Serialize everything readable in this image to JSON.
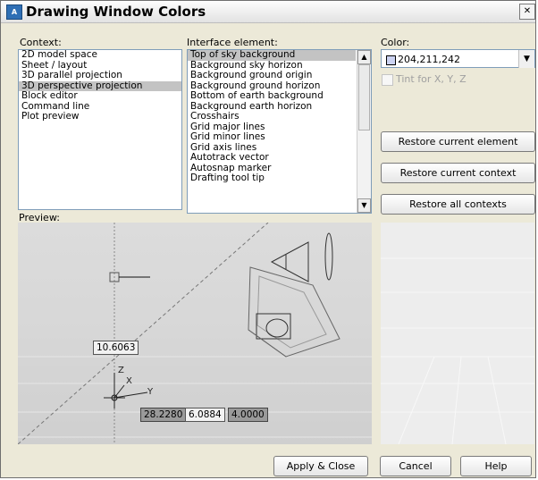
{
  "window": {
    "title": "Drawing Window Colors",
    "icon_label": "A",
    "close_glyph": "✕"
  },
  "context": {
    "label": "Context:",
    "items": [
      "2D model space",
      "Sheet / layout",
      "3D parallel projection",
      "3D perspective projection",
      "Block editor",
      "Command line",
      "Plot preview"
    ],
    "selected": "3D perspective projection"
  },
  "interface_element": {
    "label": "Interface element:",
    "items": [
      "Top of sky background",
      "Background sky horizon",
      "Background ground origin",
      "Background ground horizon",
      "Bottom of earth background",
      "Background earth horizon",
      "Crosshairs",
      "Grid major lines",
      "Grid minor lines",
      "Grid axis lines",
      "Autotrack vector",
      "Autosnap marker",
      "Drafting tool tip"
    ],
    "selected": "Top of sky background",
    "scroll_up_icon": "scroll-up-arrow",
    "scroll_down_icon": "scroll-down-arrow"
  },
  "color": {
    "label": "Color:",
    "value": "204,211,242",
    "swatch_color": "#ccd3f2",
    "tint_label": "Tint for X, Y, Z"
  },
  "buttons": {
    "restore_element": "Restore current element",
    "restore_context": "Restore current context",
    "restore_all": "Restore all contexts",
    "apply_close": "Apply & Close",
    "cancel": "Cancel",
    "help": "Help"
  },
  "preview": {
    "label": "Preview:",
    "readout_top": "10.6063",
    "readout_x": "28.2280",
    "readout_y": "6.0884",
    "readout_z": "4.0000",
    "axis_z": "Z",
    "axis_x": "X",
    "axis_y": "Y"
  }
}
